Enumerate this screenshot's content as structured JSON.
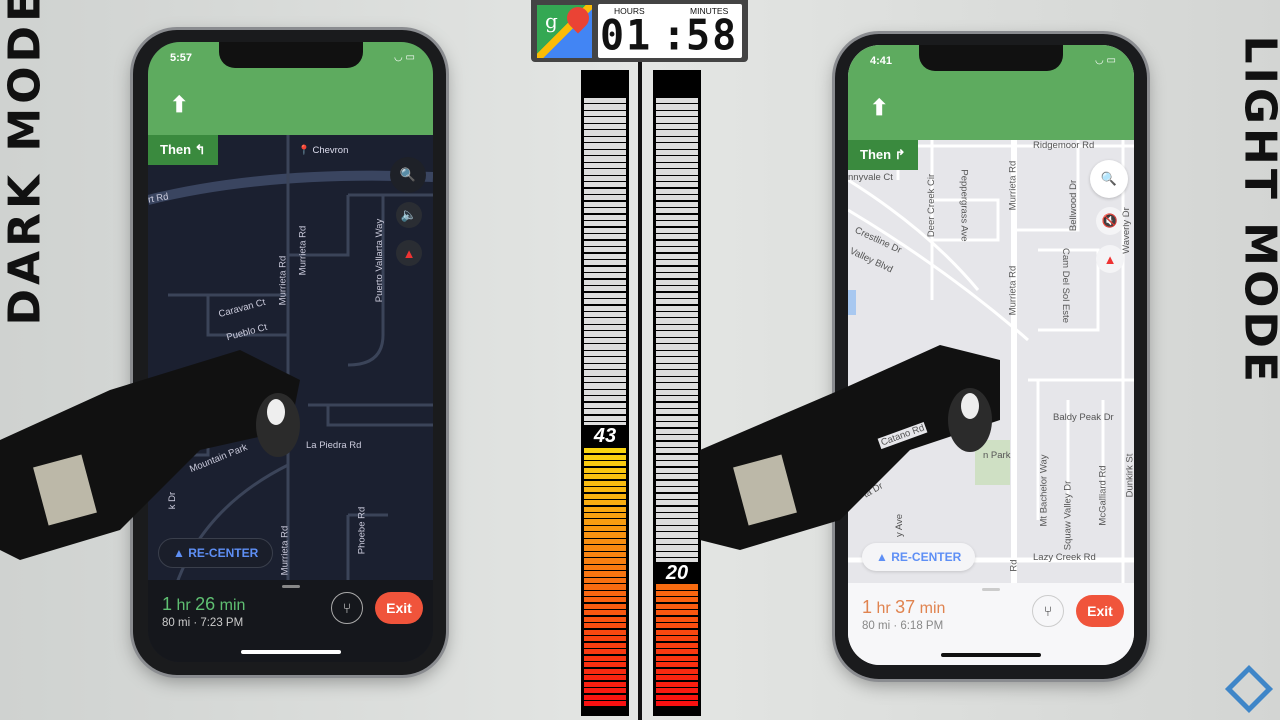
{
  "labels": {
    "left": "DARK MODE",
    "right": "LIGHT MODE"
  },
  "timer": {
    "hours_label": "HOURS",
    "minutes_label": "MINUTES",
    "hours": "01",
    "minutes": "58",
    "logo_letter": "g"
  },
  "battery": {
    "left": {
      "percent": 43,
      "label": "43"
    },
    "right": {
      "percent": 20,
      "label": "20"
    }
  },
  "dark_phone": {
    "time": "5:57",
    "status": "◡ ▭",
    "then_label": "Then ↰",
    "poi": "Chevron",
    "streets": [
      "rt Rd",
      "Murrieta Rd",
      "Murrieta Rd",
      "Puerto Vallarta Way",
      "Caravan Ct",
      "Pueblo Ct",
      "Mountain Park",
      "La Piedra Rd",
      "Murrieta Rd",
      "Phoebe Rd",
      "k Dr"
    ],
    "recenter": "RE-CENTER",
    "eta_hr": "1",
    "eta_hr_unit": "hr",
    "eta_min": "26",
    "eta_min_unit": "min",
    "trip": "80 mi · 7:23 PM",
    "exit": "Exit",
    "colors": {
      "eta": "#5fbf72",
      "map_bg": "#1b2030",
      "road": "#3b4459"
    }
  },
  "light_phone": {
    "time": "4:41",
    "status": "◡ ▭",
    "then_label": "Then ↱",
    "streets": [
      "Ridgemoor Rd",
      "nnyvale Ct",
      "Deer Creek Cir",
      "Peppergrass Ave",
      "Murrieta Rd",
      "Bellwood Dr",
      "Crestline Dr",
      "Valley Blvd",
      "Murrieta Rd",
      "Cam Del Sol Este",
      "Waverly Dr",
      "Baldy Peak Dr",
      "Catano Rd",
      "n Park",
      "Mt Bachelor Way",
      "Squaw Valley Dr",
      "McGalliard Rd",
      "Dunkirk St",
      "Lazy Creek Rd",
      "ta Dr",
      "y Ave",
      "Rd"
    ],
    "recenter": "RE-CENTER",
    "eta_hr": "1",
    "eta_hr_unit": "hr",
    "eta_min": "37",
    "eta_min_unit": "min",
    "trip": "80 mi · 6:18 PM",
    "exit": "Exit",
    "colors": {
      "eta": "#e0834f",
      "map_bg": "#e6e6ea",
      "road": "#ffffff"
    }
  }
}
